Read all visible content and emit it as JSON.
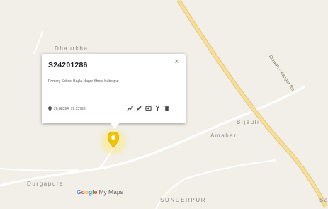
{
  "map": {
    "places": {
      "dhaurkha": "Dhaurkha",
      "bijauli": "Bijauli",
      "amahar": "Amahar",
      "durgapura": "Durgapura",
      "sunderpur": "SUNDERPUR",
      "edge": "Sa"
    },
    "road_label": "Etawah - Kanpur Rd",
    "logo": {
      "g1": "G",
      "o1": "o",
      "o2": "o",
      "g2": "g",
      "l": "l",
      "e": "e",
      "rest": "My Maps"
    },
    "colors": {
      "land": "#f1efe8",
      "highway": "#f7df9a",
      "minor_road": "#ffffff",
      "marker": "#f2c500"
    }
  },
  "popup": {
    "title": "S24201286",
    "description": "Primary School Bagla Nagar Khera Kuberpur",
    "coordinates": "26.88394, 79.13793",
    "close_symbol": "×",
    "tools": [
      "route-icon",
      "edit-icon",
      "camera-icon",
      "style-icon",
      "delete-icon"
    ]
  },
  "marker": {
    "icon": "location-pin-icon",
    "selected": true
  }
}
